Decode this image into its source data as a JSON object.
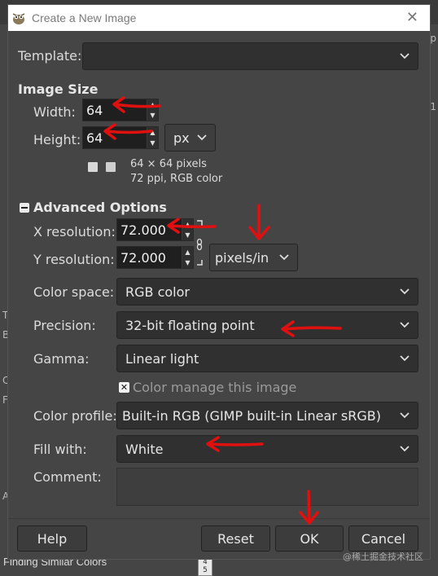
{
  "dialog": {
    "title": "Create a New Image",
    "close_glyph": "✕"
  },
  "template": {
    "label": "Template:",
    "value": ""
  },
  "image_size": {
    "section_title": "Image Size",
    "width_label": "Width:",
    "width_value": "64",
    "height_label": "Height:",
    "height_value": "64",
    "unit": "px",
    "info_line1": "64 × 64 pixels",
    "info_line2": "72 ppi, RGB color"
  },
  "advanced": {
    "section_title": "Advanced Options",
    "xres_label": "X resolution:",
    "xres_value": "72.000",
    "yres_label": "Y resolution:",
    "yres_value": "72.000",
    "res_unit": "pixels/in",
    "color_space_label": "Color space:",
    "color_space_value": "RGB color",
    "precision_label": "Precision:",
    "precision_value": "32-bit floating point",
    "gamma_label": "Gamma:",
    "gamma_value": "Linear light",
    "color_manage_label": "Color manage this image",
    "color_profile_label": "Color profile:",
    "color_profile_value": "Built-in RGB (GIMP built-in Linear sRGB)",
    "fill_label": "Fill with:",
    "fill_value": "White",
    "comment_label": "Comment:",
    "comment_value": ""
  },
  "buttons": {
    "help": "Help",
    "reset": "Reset",
    "ok": "OK",
    "cancel": "Cancel"
  },
  "background": {
    "status_text": "Finding Similar Colors",
    "ruler_a": "4",
    "ruler_b": "5",
    "watermark": "@稀土掘金技术社区",
    "left_glyphs": [
      "T",
      "B",
      "C",
      "F",
      "A"
    ],
    "right_glyphs": [
      "p",
      "1"
    ]
  },
  "colors": {
    "dialog_bg": "#454545",
    "annotation_red": "#e01010"
  }
}
